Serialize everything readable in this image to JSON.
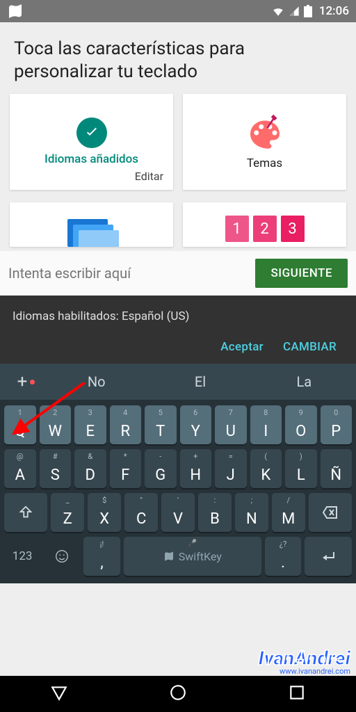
{
  "status": {
    "time": "12:06"
  },
  "header": {
    "title": "Toca las características para personalizar tu teclado"
  },
  "cards": {
    "langs": {
      "title": "Idiomas añadidos",
      "edit": "Editar"
    },
    "themes": {
      "title": "Temas"
    },
    "numbers": [
      "1",
      "2",
      "3"
    ]
  },
  "input": {
    "placeholder": "Intenta escribir aquí",
    "next": "SIGUIENTE"
  },
  "snackbar": {
    "msg": "Idiomas habilitados: Español (US)",
    "accept": "Aceptar",
    "change": "CAMBIAR"
  },
  "suggestions": {
    "plus": "+",
    "items": [
      "No",
      "El",
      "La"
    ]
  },
  "keyboard": {
    "row1": [
      {
        "k": "Q",
        "s": "1"
      },
      {
        "k": "W",
        "s": "2"
      },
      {
        "k": "E",
        "s": "3"
      },
      {
        "k": "R",
        "s": "4"
      },
      {
        "k": "T",
        "s": "5"
      },
      {
        "k": "Y",
        "s": "6"
      },
      {
        "k": "U",
        "s": "7"
      },
      {
        "k": "I",
        "s": "8"
      },
      {
        "k": "O",
        "s": "9"
      },
      {
        "k": "P",
        "s": "0"
      }
    ],
    "row2": [
      {
        "k": "A",
        "s": "@"
      },
      {
        "k": "S",
        "s": "#"
      },
      {
        "k": "D",
        "s": "&"
      },
      {
        "k": "F",
        "s": "*"
      },
      {
        "k": "G",
        "s": "-"
      },
      {
        "k": "H",
        "s": "+"
      },
      {
        "k": "J",
        "s": "="
      },
      {
        "k": "K",
        "s": "("
      },
      {
        "k": "L",
        "s": ")"
      },
      {
        "k": "Ñ",
        "s": ""
      }
    ],
    "row3": [
      {
        "k": "Z",
        "s": "_"
      },
      {
        "k": "X",
        "s": "$"
      },
      {
        "k": "C",
        "s": "\""
      },
      {
        "k": "V",
        "s": "'"
      },
      {
        "k": "B",
        "s": ":"
      },
      {
        "k": "N",
        "s": ";"
      },
      {
        "k": "M",
        "s": "/"
      }
    ],
    "row4": {
      "num": "123",
      "comma": {
        "k": ",",
        "s": "¡!"
      },
      "space": "SwiftKey",
      "period": {
        "k": ".",
        "s": "¿?"
      }
    }
  },
  "watermark": {
    "name": "IvanAndrei",
    "url": "www.ivanandrei.com"
  }
}
